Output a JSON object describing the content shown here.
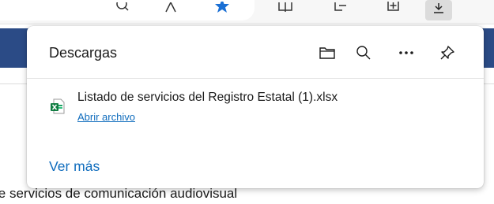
{
  "page": {
    "background_text": "le servicios de comunicación audiovisual",
    "banner_color": "#2b4b86"
  },
  "toolbar": {
    "icons": [
      "search-icon",
      "read-aloud-icon",
      "favorite-star-icon",
      "split-screen-icon",
      "favorites-icon",
      "collections-icon",
      "downloads-icon"
    ],
    "active": "downloads-icon",
    "accent": "#0f6cbd"
  },
  "downloads": {
    "title": "Descargas",
    "header_icons": [
      "folder-icon",
      "search-icon",
      "more-options-icon",
      "pin-icon"
    ],
    "items": [
      {
        "file_name": "Listado de servicios del Registro Estatal (1).xlsx",
        "action_label": "Abrir archivo",
        "icon": "excel-file-icon"
      }
    ],
    "see_more_label": "Ver más",
    "link_color": "#0f6cbd"
  }
}
